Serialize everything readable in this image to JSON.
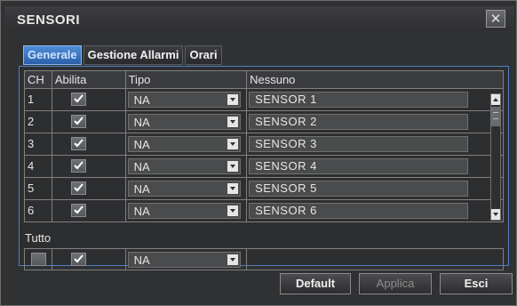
{
  "window": {
    "title": "SENSORI",
    "close_symbol": "✕"
  },
  "tabs": [
    {
      "label": "Generale",
      "active": true
    },
    {
      "label": "Gestione Allarmi",
      "active": false
    },
    {
      "label": "Orari",
      "active": false
    }
  ],
  "table": {
    "headers": [
      "CH",
      "Abilita",
      "Tipo",
      "Nessuno"
    ],
    "rows": [
      {
        "ch": "1",
        "enabled": true,
        "type": "NA",
        "name": "SENSOR 1"
      },
      {
        "ch": "2",
        "enabled": true,
        "type": "NA",
        "name": "SENSOR 2"
      },
      {
        "ch": "3",
        "enabled": true,
        "type": "NA",
        "name": "SENSOR 3"
      },
      {
        "ch": "4",
        "enabled": true,
        "type": "NA",
        "name": "SENSOR 4"
      },
      {
        "ch": "5",
        "enabled": true,
        "type": "NA",
        "name": "SENSOR 5"
      },
      {
        "ch": "6",
        "enabled": true,
        "type": "NA",
        "name": "SENSOR 6"
      }
    ]
  },
  "tutto": {
    "label": "Tutto",
    "enabled": true,
    "type": "NA"
  },
  "buttons": {
    "default": "Default",
    "applica": "Applica",
    "esci": "Esci"
  },
  "colors": {
    "accent_tab": "#3a78c8",
    "panel_border": "#4f7fc4",
    "background": "#303133"
  }
}
